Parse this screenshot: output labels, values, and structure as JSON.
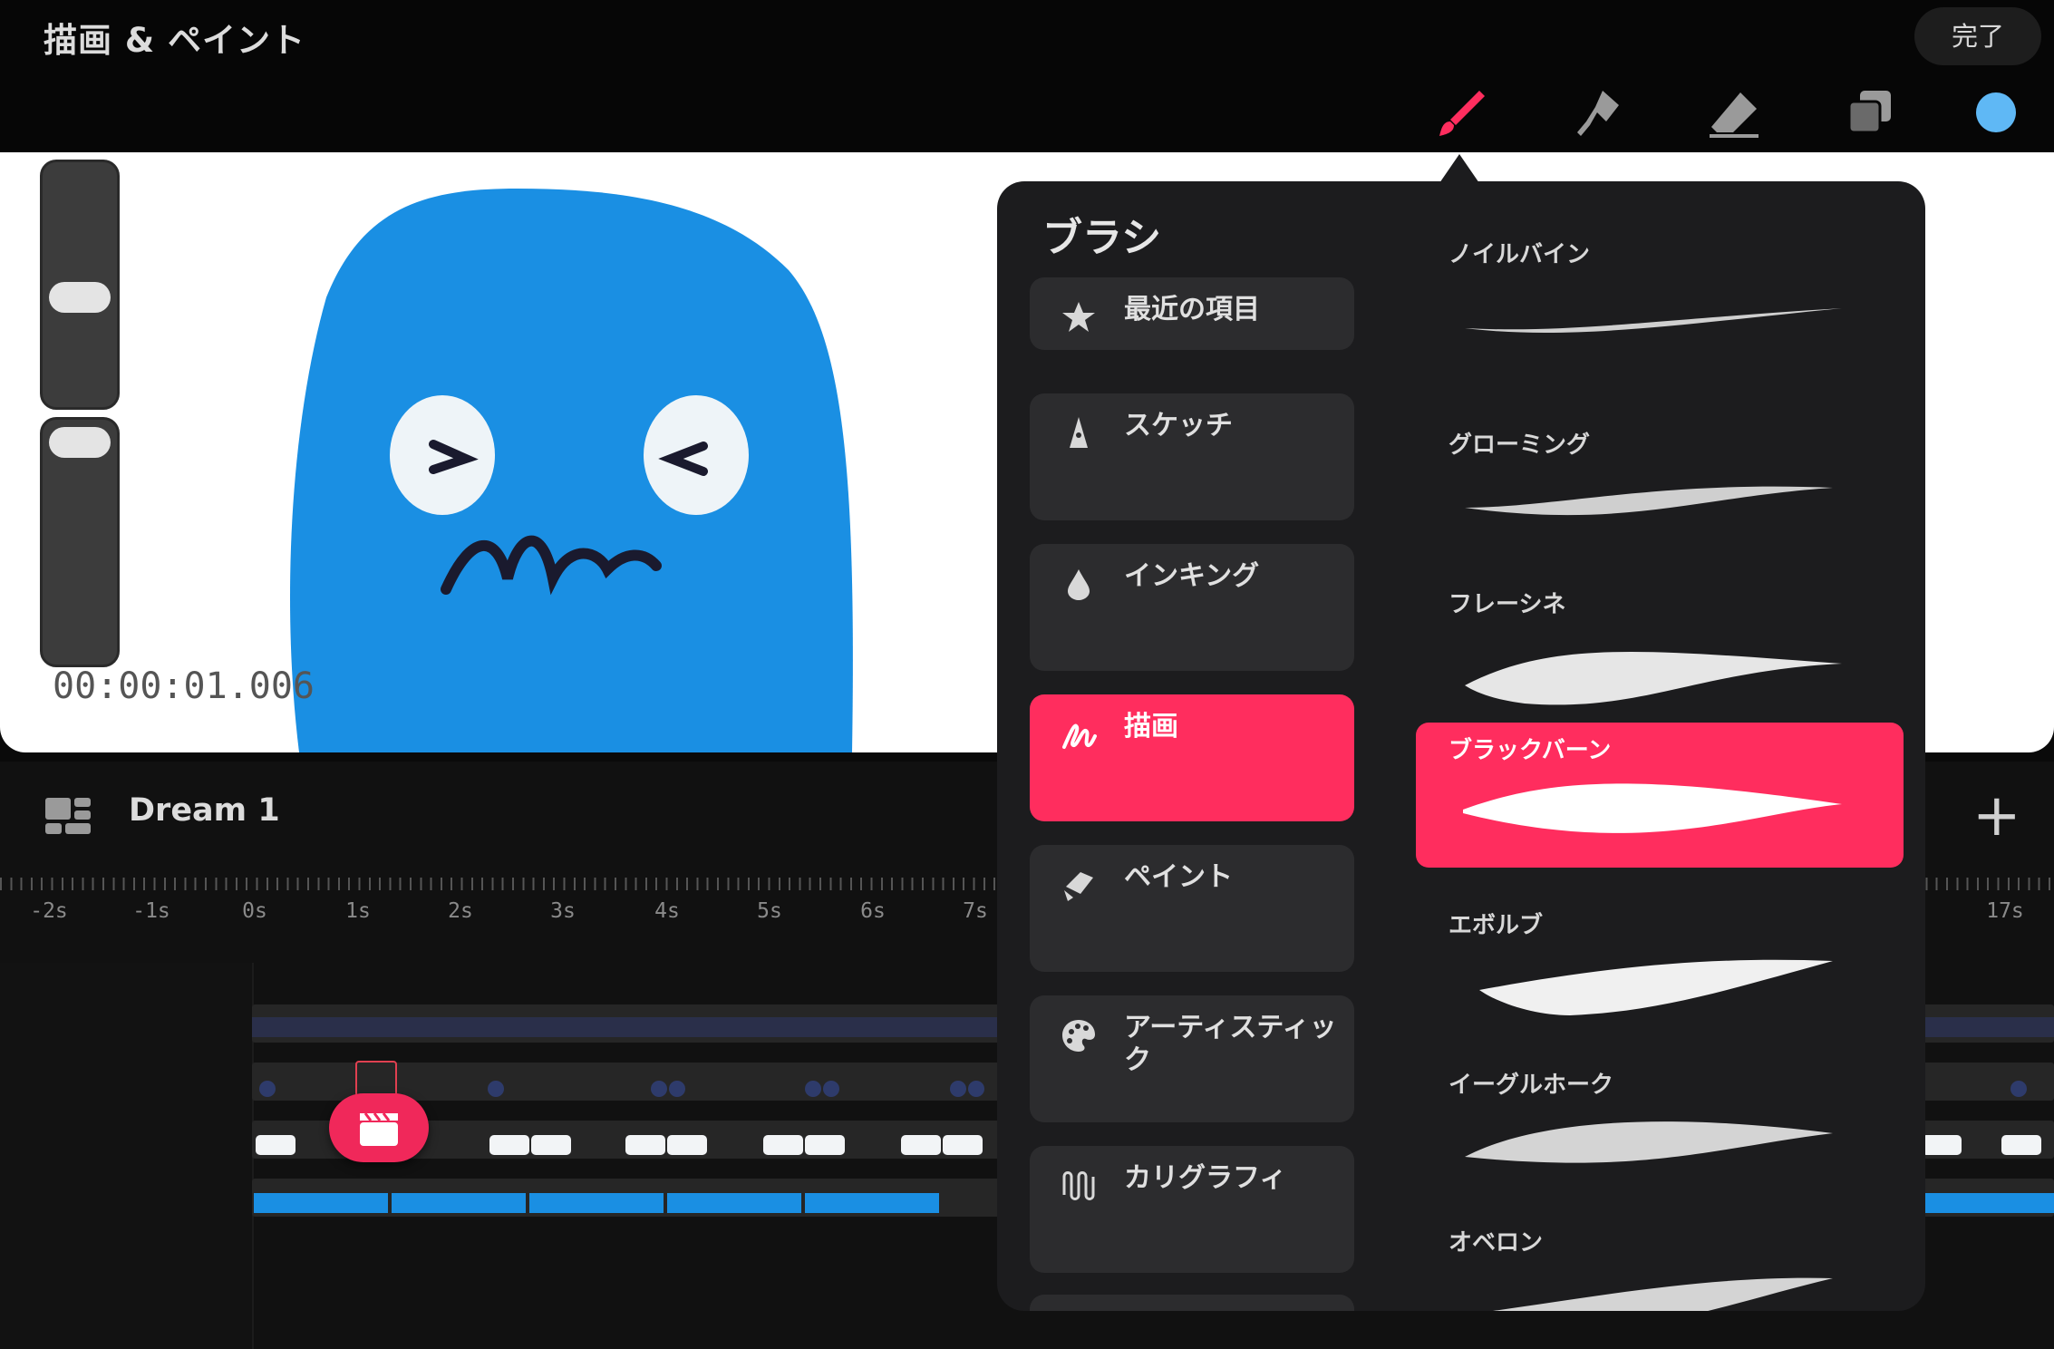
{
  "app": {
    "title": "描画 & ペイント",
    "done_label": "完了"
  },
  "toolbar": {
    "tools": [
      "paintbrush-icon",
      "smudge-icon",
      "eraser-icon",
      "layers-icon"
    ],
    "current_color": "#5fb8f5"
  },
  "canvas": {
    "timecode": "00:00:01.006"
  },
  "timeline": {
    "title": "Dream 1",
    "ruler_labels": [
      "-2s",
      "-1s",
      "0s",
      "1s",
      "2s",
      "3s",
      "4s",
      "5s",
      "6s",
      "7s",
      "17s"
    ]
  },
  "brush_panel": {
    "title": "ブラシ",
    "categories": [
      {
        "label": "最近の項目",
        "icon": "star-icon"
      },
      {
        "label": "スケッチ",
        "icon": "pencil-tip-icon"
      },
      {
        "label": "インキング",
        "icon": "ink-drop-icon"
      },
      {
        "label": "描画",
        "icon": "draw-scribble-icon",
        "selected": true
      },
      {
        "label": "ペイント",
        "icon": "paint-brush-icon"
      },
      {
        "label": "アーティスティック",
        "icon": "palette-icon"
      },
      {
        "label": "カリグラフィ",
        "icon": "calligraphy-icon"
      }
    ],
    "brushes": [
      {
        "name": "ノイルバイン"
      },
      {
        "name": "グローミング"
      },
      {
        "name": "フレーシネ"
      },
      {
        "name": "ブラックバーン",
        "selected": true
      },
      {
        "name": "エボルブ"
      },
      {
        "name": "イーグルホーク"
      },
      {
        "name": "オベロン"
      }
    ]
  },
  "colors": {
    "accent": "#ff2d5e",
    "blue": "#1a8fe3"
  }
}
